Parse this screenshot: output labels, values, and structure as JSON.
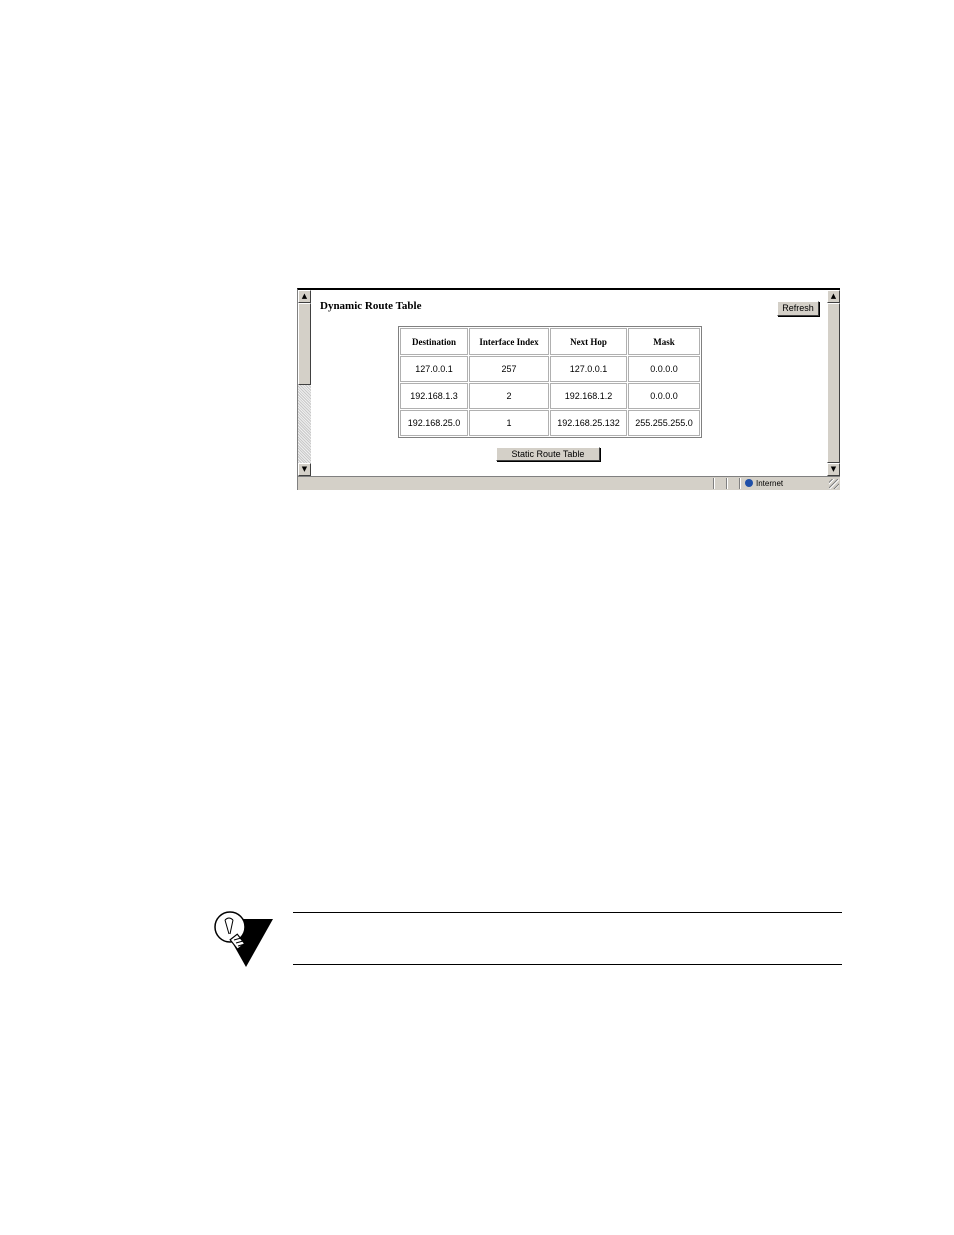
{
  "page": {
    "title": "Dynamic Route Table",
    "refresh_label": "Refresh",
    "static_button_label": "Static Route Table"
  },
  "table": {
    "headers": [
      "Destination",
      "Interface Index",
      "Next Hop",
      "Mask"
    ],
    "rows": [
      [
        "127.0.0.1",
        "257",
        "127.0.0.1",
        "0.0.0.0"
      ],
      [
        "192.168.1.3",
        "2",
        "192.168.1.2",
        "0.0.0.0"
      ],
      [
        "192.168.25.0",
        "1",
        "192.168.25.132",
        "255.255.255.0"
      ]
    ]
  },
  "statusbar": {
    "zone": "Internet"
  },
  "icons": {
    "up_arrow": "▲",
    "down_arrow": "▼",
    "note_icon": "lightbulb-tip-icon"
  },
  "colors": {
    "window_chrome": "#d4d0c8",
    "tip_triangle": "#000000"
  }
}
